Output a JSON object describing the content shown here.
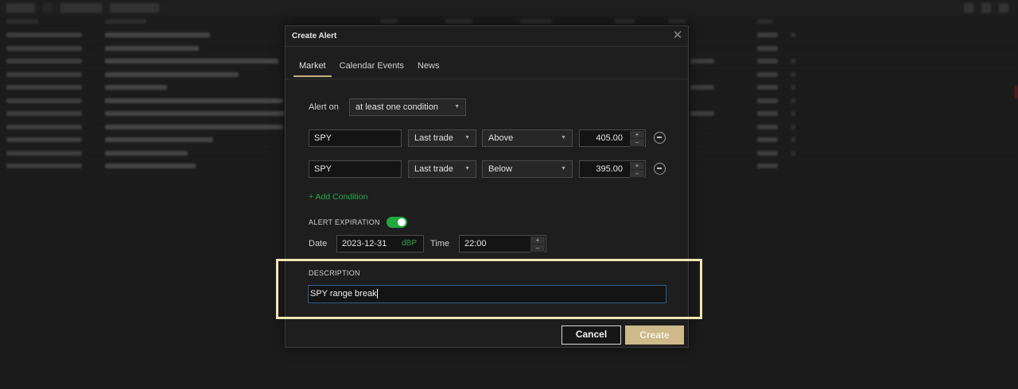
{
  "modal": {
    "title": "Create Alert",
    "close_icon": "close-icon",
    "tabs": [
      {
        "label": "Market",
        "active": true
      },
      {
        "label": "Calendar Events",
        "active": false
      },
      {
        "label": "News",
        "active": false
      }
    ],
    "alert_on_label": "Alert on",
    "alert_on_value": "at least one condition",
    "conditions": [
      {
        "symbol": "SPY",
        "field": "Last trade",
        "operator": "Above",
        "value": "405.00"
      },
      {
        "symbol": "SPY",
        "field": "Last trade",
        "operator": "Below",
        "value": "395.00"
      }
    ],
    "add_condition_label": "+ Add Condition",
    "expiration_label": "ALERT EXPIRATION",
    "expiration_enabled": true,
    "date_label": "Date",
    "date_value": "2023-12-31",
    "date_suffix": "dBP",
    "time_label": "Time",
    "time_value": "22:00",
    "description_label": "DESCRIPTION",
    "description_value": "SPY range break",
    "cancel_label": "Cancel",
    "create_label": "Create",
    "colors": {
      "accent": "#cdb98a",
      "toggle": "#1fa83c",
      "add_condition": "#2aa84a",
      "highlight_frame": "#efe6b2"
    }
  }
}
